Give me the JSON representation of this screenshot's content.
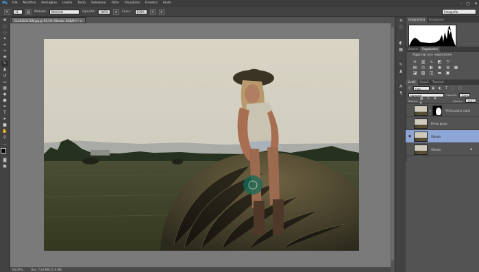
{
  "app": {
    "logo": "Ps"
  },
  "menu": [
    "File",
    "Modifica",
    "Immagine",
    "Livello",
    "Testo",
    "Selezione",
    "Filtro",
    "Visualizza",
    "Finestra",
    "Aiuto"
  ],
  "window_controls": [
    "–",
    "▢",
    "✕"
  ],
  "options": {
    "brush_size": "11",
    "mode_label": "Metodo:",
    "mode_value": "Normale",
    "opacity_label": "Opacità:",
    "opacity_value": "100%",
    "flow_label": "Fluss.:",
    "flow_value": "100%",
    "workspace": "Fotografia"
  },
  "document": {
    "tab_title": "CLASSICO DIN.jpg @ 63,1% (Sfondo, RGB/8*) *",
    "zoom": "63,07%",
    "doc_info": "Doc: 7,62 MB/15,9 MB"
  },
  "panels": {
    "top_tabs": [
      "Istogramma",
      "Navigatore"
    ],
    "mid_tabs": [
      "Librerie",
      "Regolazioni"
    ],
    "adjust_title": "Aggiungi una regolazione",
    "layers_tabs": [
      "Livelli",
      "Canali",
      "Tracciati"
    ],
    "kind_filter": "Tipo",
    "blend_mode": "Normale",
    "opacity_label": "Opacità:",
    "opacity_value": "100%",
    "lock_label": "Blocca:",
    "fill_label": "Riemp.:",
    "fill_value": "100%",
    "layers": [
      {
        "name": "Primo piano copia",
        "selected": false,
        "mask": true
      },
      {
        "name": "Primo piano",
        "selected": false,
        "mask": false
      },
      {
        "name": "Sfondo",
        "selected": true,
        "mask": false
      },
      {
        "name": "Sfondo",
        "selected": false,
        "mask": false
      }
    ]
  }
}
